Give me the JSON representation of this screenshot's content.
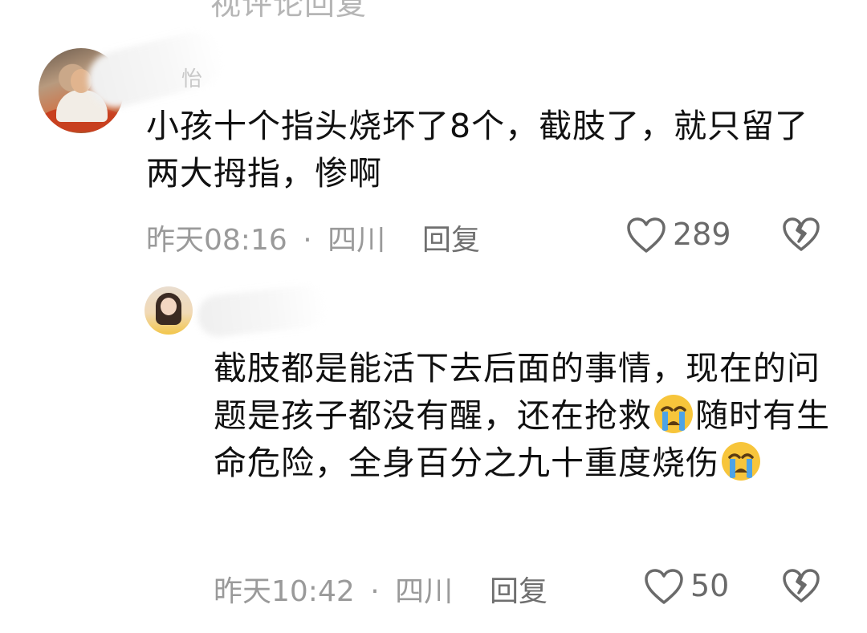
{
  "top_cut_text": "视评论回复",
  "comments": [
    {
      "author_fragment": "怡",
      "text": "小孩十个指头烧坏了8个，截肢了，就只留了两大拇指，惨啊",
      "time": "昨天08:16",
      "location": "四川",
      "separator": "·",
      "reply_label": "回复",
      "likes": "289"
    },
    {
      "text_part1": "截肢都是能活下去后面的事情，现在的问题是孩子都没有醒，还在抢救",
      "text_part2": "随时有生命危险，全身百分之九十重度烧伤",
      "time": "昨天10:42",
      "location": "四川",
      "separator": "·",
      "reply_label": "回复",
      "likes": "50"
    }
  ],
  "icons": {
    "like": "heart-outline-icon",
    "dislike": "broken-heart-icon",
    "emoji": "loudly-crying-face-emoji"
  },
  "colors": {
    "text": "#111111",
    "meta": "#9a9a9a",
    "icon": "#6a6a6a"
  }
}
